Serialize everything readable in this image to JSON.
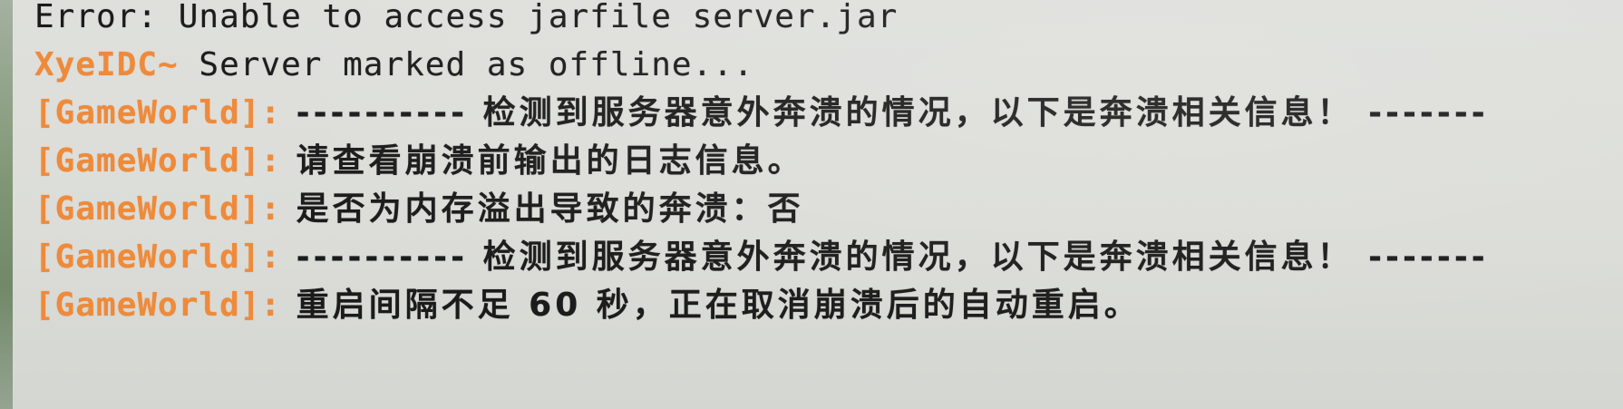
{
  "console": {
    "lines": [
      {
        "prefix": "",
        "text": "Error: Unable to access jarfile server.jar"
      },
      {
        "prefix": "XyeIDC~",
        "text": " Server marked as offline..."
      },
      {
        "prefix": "[GameWorld]:",
        "text": " ---------- 检测到服务器意外奔溃的情况，以下是奔溃相关信息！ -------"
      },
      {
        "prefix": "[GameWorld]:",
        "text": " 请查看崩溃前输出的日志信息。"
      },
      {
        "prefix": "[GameWorld]:",
        "text": " 是否为内存溢出导致的奔溃：否"
      },
      {
        "prefix": "[GameWorld]:",
        "text": " ---------- 检测到服务器意外奔溃的情况，以下是奔溃相关信息！ -------"
      },
      {
        "prefix": "[GameWorld]:",
        "text": " 重启间隔不足 60 秒，正在取消崩溃后的自动重启。"
      }
    ]
  }
}
